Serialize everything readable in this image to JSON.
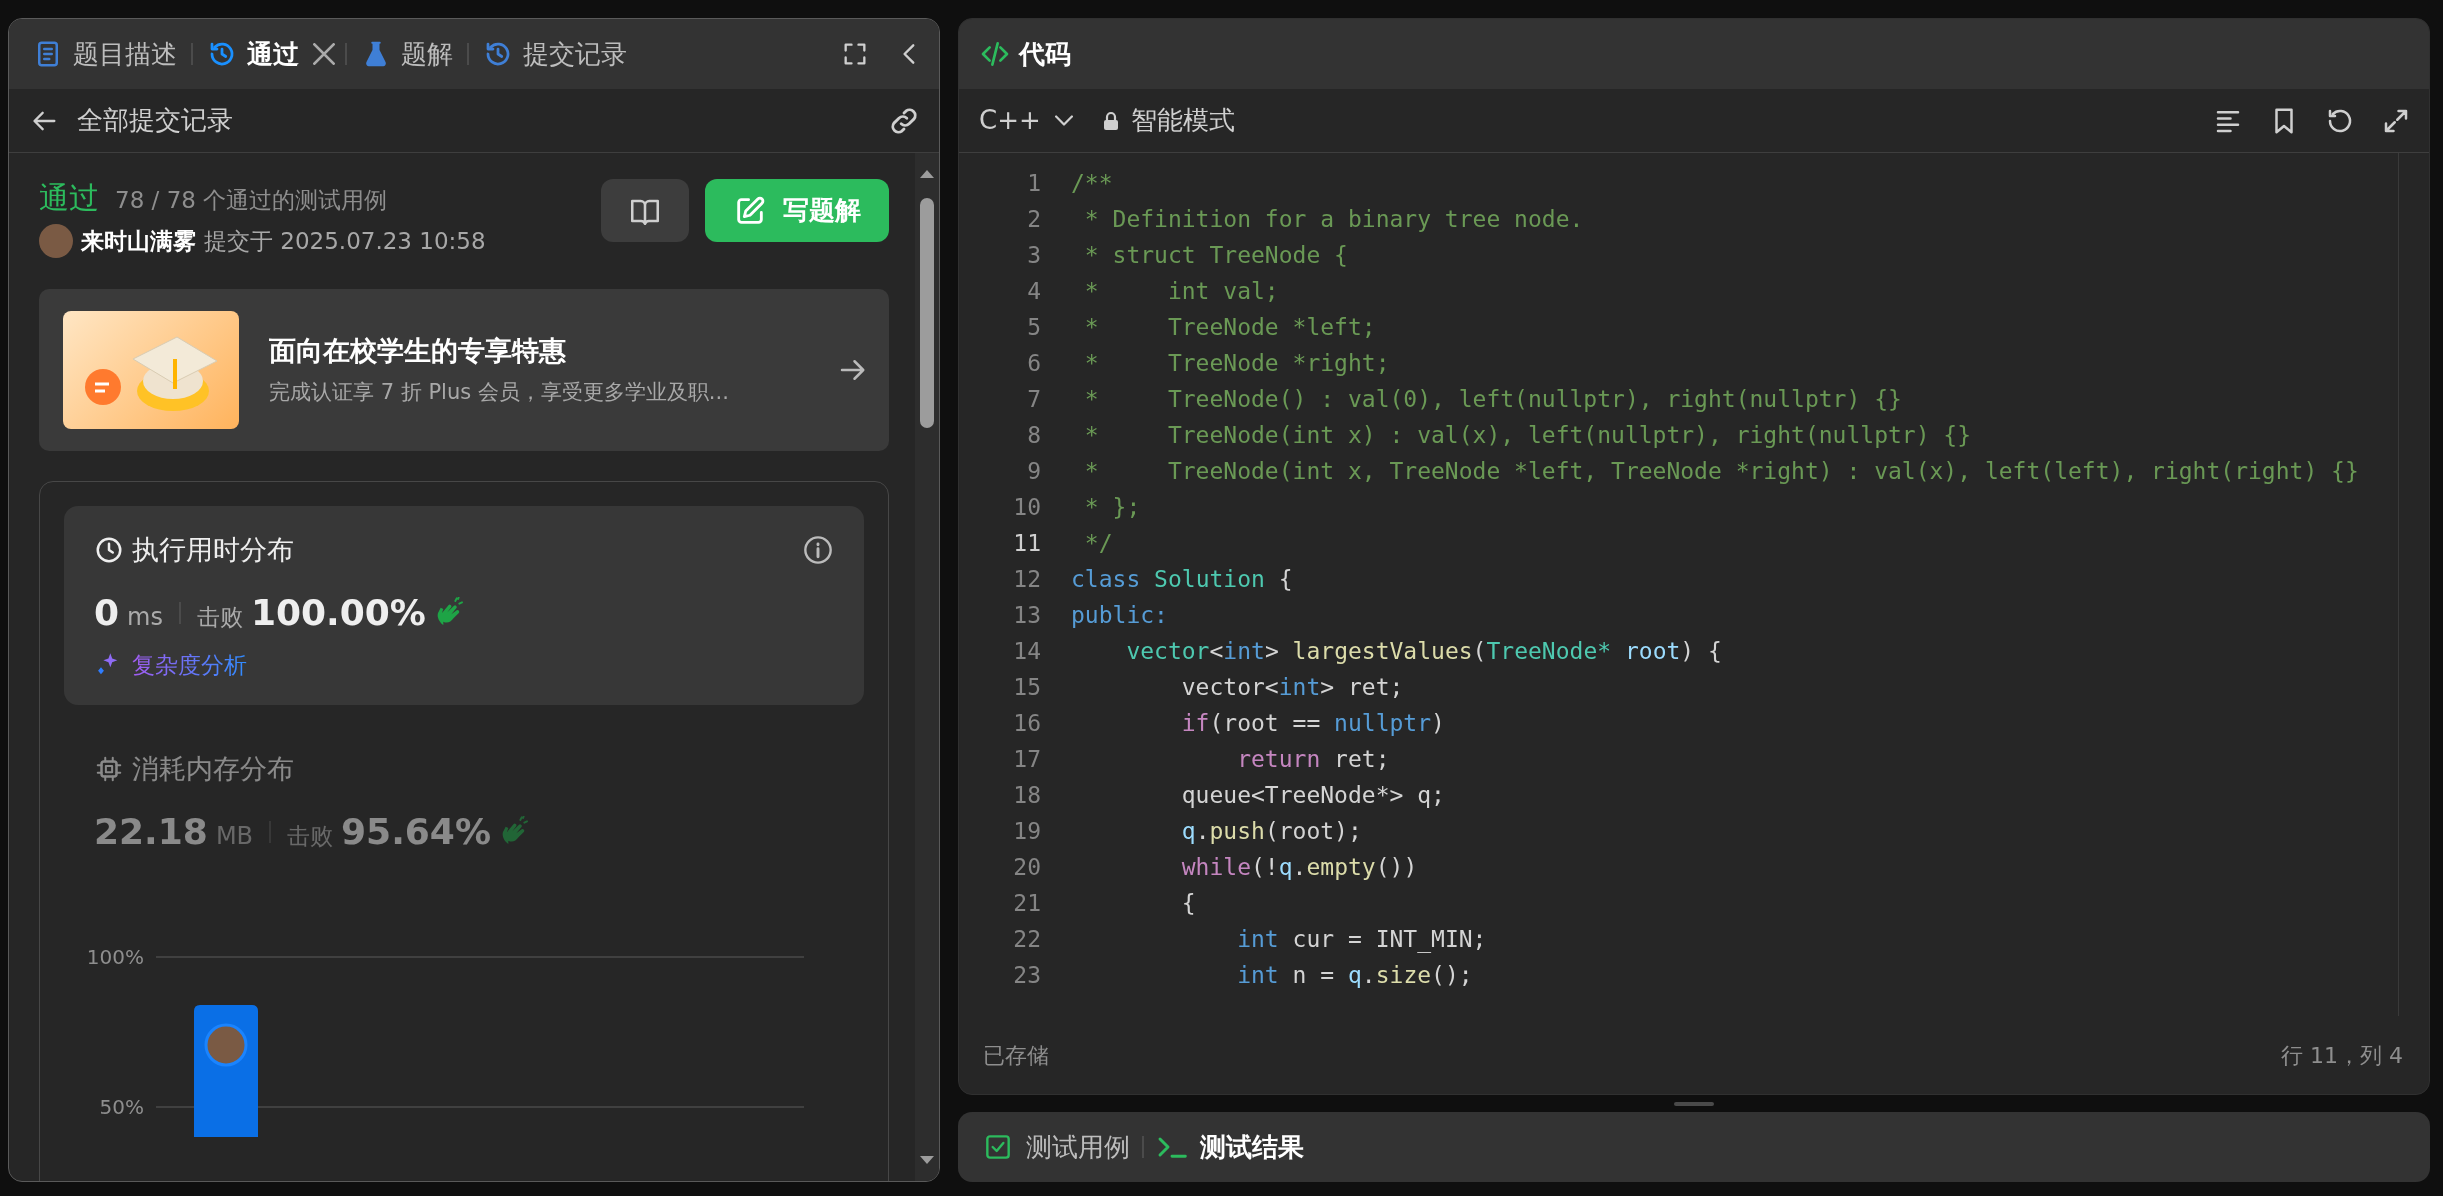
{
  "left_panel": {
    "tabs": [
      {
        "label": "题目描述",
        "kind": "description",
        "selected": false,
        "closable": false
      },
      {
        "label": "通过",
        "kind": "submission",
        "selected": true,
        "closable": true
      },
      {
        "label": "题解",
        "kind": "solution",
        "selected": false,
        "closable": false
      },
      {
        "label": "提交记录",
        "kind": "history",
        "selected": false,
        "closable": false
      }
    ],
    "back_label": "全部提交记录"
  },
  "result": {
    "status": "通过",
    "summary": "78 / 78 个通过的测试用例",
    "author": "来时山满雾",
    "submitted": "提交于 2025.07.23 10:58",
    "solution_button": "写题解"
  },
  "promo": {
    "title": "面向在校学生的专享特惠",
    "subtitle": "完成认证享 7 折 Plus 会员，享受更多学业及职..."
  },
  "metrics": [
    {
      "kind": "runtime",
      "selected": true,
      "title": "执行用时分布",
      "value": "0",
      "unit": "ms",
      "beats_label": "击败",
      "beats": "100.00%",
      "link": "复杂度分析"
    },
    {
      "kind": "memory",
      "selected": false,
      "title": "消耗内存分布",
      "value": "22.18",
      "unit": "MB",
      "beats_label": "击败",
      "beats": "95.64%"
    }
  ],
  "chart_data": {
    "type": "bar",
    "values": [
      84
    ],
    "ylim": [
      40,
      100
    ],
    "yticks": [
      {
        "value": 100,
        "label": "100%"
      },
      {
        "value": 50,
        "label": "50%"
      }
    ]
  },
  "editor": {
    "title": "代码",
    "language": "C++",
    "mode": "智能模式",
    "status": "已存储",
    "cursor": "行 11，列 4",
    "lines": [
      {
        "number": "1",
        "current": false,
        "tokens": [
          {
            "text": "/**",
            "kind": "comment"
          }
        ]
      },
      {
        "number": "2",
        "current": false,
        "tokens": [
          {
            "text": " * Definition for a binary tree node.",
            "kind": "comment"
          }
        ]
      },
      {
        "number": "3",
        "current": false,
        "tokens": [
          {
            "text": " * struct TreeNode {",
            "kind": "comment"
          }
        ]
      },
      {
        "number": "4",
        "current": false,
        "tokens": [
          {
            "text": " *     int val;",
            "kind": "comment"
          }
        ]
      },
      {
        "number": "5",
        "current": false,
        "tokens": [
          {
            "text": " *     TreeNode *left;",
            "kind": "comment"
          }
        ]
      },
      {
        "number": "6",
        "current": false,
        "tokens": [
          {
            "text": " *     TreeNode *right;",
            "kind": "comment"
          }
        ]
      },
      {
        "number": "7",
        "current": false,
        "tokens": [
          {
            "text": " *     TreeNode() : val(0), left(nullptr), right(nullptr) {}",
            "kind": "comment"
          }
        ]
      },
      {
        "number": "8",
        "current": false,
        "tokens": [
          {
            "text": " *     TreeNode(int x) : val(x), left(nullptr), right(nullptr) {}",
            "kind": "comment"
          }
        ]
      },
      {
        "number": "9",
        "current": false,
        "tokens": [
          {
            "text": " *     TreeNode(int x, TreeNode *left, TreeNode *right) : val(x), left(left), right(right) {}",
            "kind": "comment"
          }
        ]
      },
      {
        "number": "10",
        "current": false,
        "tokens": [
          {
            "text": " * };",
            "kind": "comment"
          }
        ]
      },
      {
        "number": "11",
        "current": true,
        "tokens": [
          {
            "text": " */",
            "kind": "comment"
          }
        ]
      },
      {
        "number": "12",
        "current": false,
        "tokens": [
          {
            "text": "class ",
            "kind": "keyword"
          },
          {
            "text": "Solution",
            "kind": "type"
          },
          {
            "text": " {",
            "kind": "plain"
          }
        ]
      },
      {
        "number": "13",
        "current": false,
        "tokens": [
          {
            "text": "public:",
            "kind": "keyword"
          }
        ]
      },
      {
        "number": "14",
        "current": false,
        "tokens": [
          {
            "text": "    vector",
            "kind": "type"
          },
          {
            "text": "<",
            "kind": "plain"
          },
          {
            "text": "int",
            "kind": "keyword"
          },
          {
            "text": "> ",
            "kind": "plain"
          },
          {
            "text": "largestValues",
            "kind": "function"
          },
          {
            "text": "(",
            "kind": "plain"
          },
          {
            "text": "TreeNode* ",
            "kind": "type"
          },
          {
            "text": "root",
            "kind": "variable"
          },
          {
            "text": ") {",
            "kind": "plain"
          }
        ]
      },
      {
        "number": "15",
        "current": false,
        "tokens": [
          {
            "text": "        vector<",
            "kind": "plain"
          },
          {
            "text": "int",
            "kind": "keyword"
          },
          {
            "text": "> ret;",
            "kind": "plain"
          }
        ]
      },
      {
        "number": "16",
        "current": false,
        "tokens": [
          {
            "text": "        if",
            "kind": "control"
          },
          {
            "text": "(root == ",
            "kind": "plain"
          },
          {
            "text": "nullptr",
            "kind": "keyword"
          },
          {
            "text": ")",
            "kind": "plain"
          }
        ]
      },
      {
        "number": "17",
        "current": false,
        "tokens": [
          {
            "text": "            return",
            "kind": "control"
          },
          {
            "text": " ret;",
            "kind": "plain"
          }
        ]
      },
      {
        "number": "18",
        "current": false,
        "tokens": [
          {
            "text": "        queue<TreeNode*> q;",
            "kind": "plain"
          }
        ]
      },
      {
        "number": "19",
        "current": false,
        "tokens": [
          {
            "text": "        q",
            "kind": "variable"
          },
          {
            "text": ".",
            "kind": "plain"
          },
          {
            "text": "push",
            "kind": "function"
          },
          {
            "text": "(root);",
            "kind": "plain"
          }
        ]
      },
      {
        "number": "20",
        "current": false,
        "tokens": [
          {
            "text": "        while",
            "kind": "control"
          },
          {
            "text": "(!",
            "kind": "plain"
          },
          {
            "text": "q",
            "kind": "variable"
          },
          {
            "text": ".",
            "kind": "plain"
          },
          {
            "text": "empty",
            "kind": "function"
          },
          {
            "text": "())",
            "kind": "plain"
          }
        ]
      },
      {
        "number": "21",
        "current": false,
        "tokens": [
          {
            "text": "        {",
            "kind": "plain"
          }
        ]
      },
      {
        "number": "22",
        "current": false,
        "tokens": [
          {
            "text": "            int",
            "kind": "keyword"
          },
          {
            "text": " cur = INT_MIN;",
            "kind": "plain"
          }
        ]
      },
      {
        "number": "23",
        "current": false,
        "tokens": [
          {
            "text": "            int",
            "kind": "keyword"
          },
          {
            "text": " n = ",
            "kind": "plain"
          },
          {
            "text": "q",
            "kind": "variable"
          },
          {
            "text": ".",
            "kind": "plain"
          },
          {
            "text": "size",
            "kind": "function"
          },
          {
            "text": "();",
            "kind": "plain"
          }
        ]
      }
    ]
  },
  "bottom_tabs": [
    {
      "label": "测试用例",
      "kind": "testcase",
      "selected": false
    },
    {
      "label": "测试结果",
      "kind": "result",
      "selected": true
    }
  ]
}
